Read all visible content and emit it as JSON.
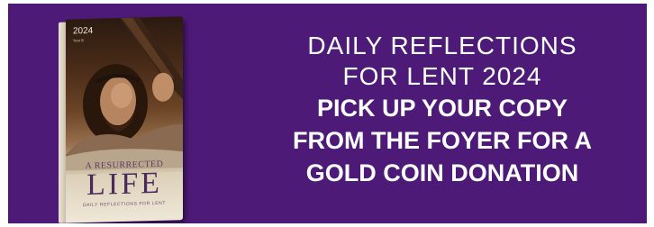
{
  "book": {
    "year": "2024",
    "year_sub": "Year B",
    "title_small": "A RESURRECTED",
    "title_large": "LIFE",
    "subtitle": "DAILY REFLECTIONS FOR LENT"
  },
  "headline": {
    "line1": "DAILY REFLECTIONS",
    "line2": "FOR LENT 2024"
  },
  "message": {
    "line1": "PICK UP YOUR COPY",
    "line2": "FROM THE FOYER FOR A",
    "line3": "GOLD COIN DONATION"
  },
  "colors": {
    "background": "#4d1b77",
    "text": "#ffffff"
  }
}
